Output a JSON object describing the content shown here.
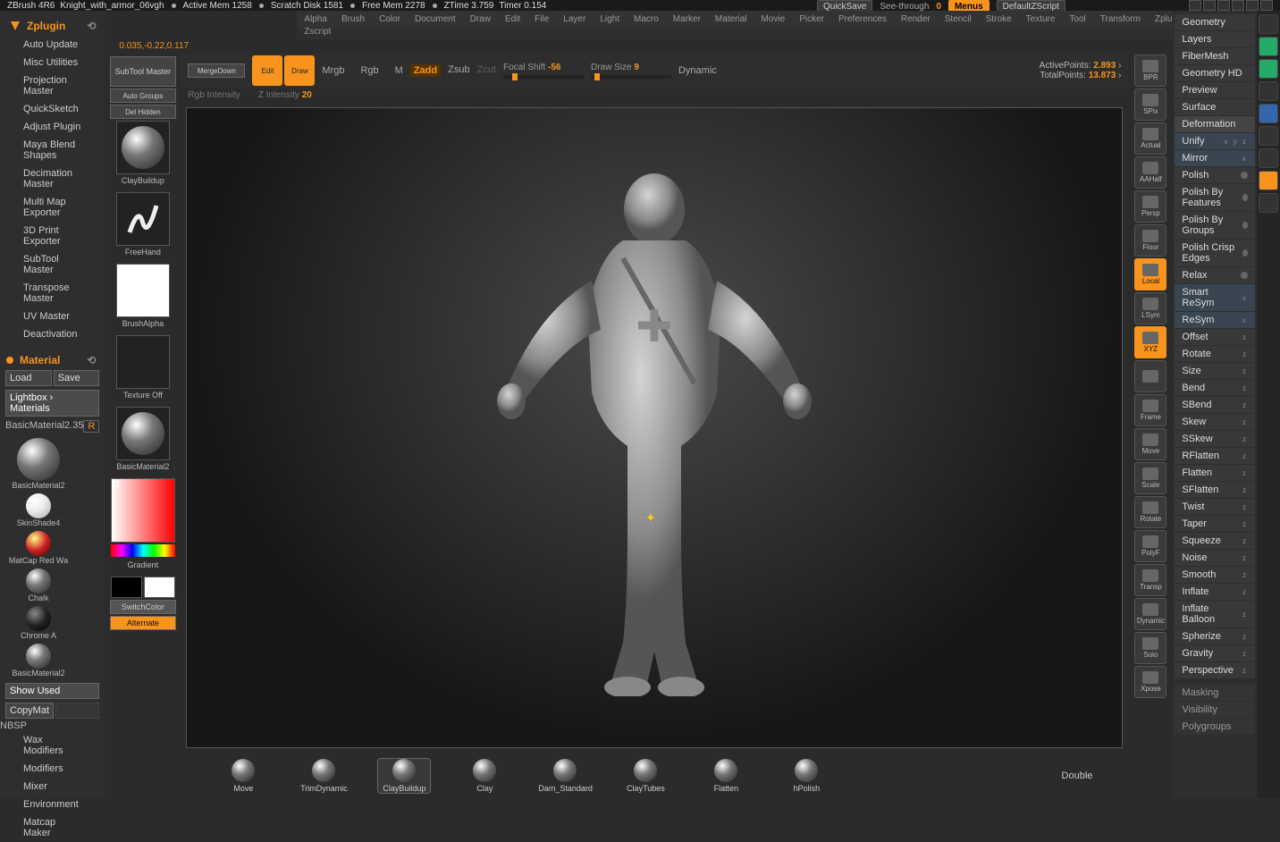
{
  "app": {
    "name": "ZBrush 4R6",
    "doc": "Knight_with_armor_06vgh"
  },
  "status": {
    "active_mem": "Active Mem 1258",
    "scratch": "Scratch Disk 1581",
    "free": "Free Mem 2278",
    "ztime": "ZTime  3.759",
    "timer": "Timer  0.154"
  },
  "header": {
    "quicksave": "QuickSave",
    "seethrough": "See-through",
    "seethrough_val": "0",
    "menus": "Menus",
    "zscript": "DefaultZScript"
  },
  "menu": [
    "Alpha",
    "Brush",
    "Color",
    "Document",
    "Draw",
    "Edit",
    "File",
    "Layer",
    "Light",
    "Macro",
    "Marker",
    "Material",
    "Movie",
    "Picker",
    "Preferences",
    "Render",
    "Stencil",
    "Stroke",
    "Texture",
    "Tool",
    "Transform",
    "Zplugin"
  ],
  "breadcrumb": "Zscript",
  "coords": "0.035,-0.22,0.117",
  "zplugin": {
    "title": "Zplugin",
    "items": [
      "Auto Update",
      "Misc Utilities",
      "Projection Master",
      "QuickSketch",
      "Adjust Plugin",
      "Maya Blend Shapes",
      "Decimation Master",
      "Multi Map Exporter",
      "3D Print Exporter",
      "SubTool Master",
      "Transpose Master",
      "UV Master",
      "Deactivation"
    ]
  },
  "material": {
    "title": "Material",
    "load": "Load",
    "save": "Save",
    "lightbox": "Lightbox › Materials",
    "base": "BasicMaterial2.",
    "baseval": "35",
    "r": "R",
    "thumbs": [
      "BasicMaterial2",
      "SkinShade4",
      "MatCap Red Wa",
      "Chalk",
      "Chrome A",
      "BasicMaterial2"
    ],
    "show_used": "Show Used",
    "copymat": "CopyMat",
    "extras": [
      "Wax Modifiers",
      "Modifiers",
      "Mixer",
      "Environment",
      "Matcap Maker"
    ]
  },
  "tool": {
    "subtool": "SubTool Master",
    "autogroups": "Auto Groups",
    "mergedown": "MergeDown",
    "delhidden": "Del Hidden",
    "brush": "ClayBuildup",
    "stroke": "FreeHand",
    "alpha": "BrushAlpha",
    "texture": "Texture Off",
    "mat": "BasicMaterial2",
    "gradient": "Gradient",
    "switch": "SwitchColor",
    "alternate": "Alternate"
  },
  "top": {
    "edit": "Edit",
    "draw": "Draw",
    "modes": [
      "Mrgb",
      "Rgb",
      "M"
    ],
    "zadd": "Zadd",
    "zsub": "Zsub",
    "zcut": "Zcut",
    "rgbint": "Rgb Intensity",
    "zint": "Z Intensity",
    "zint_val": "20",
    "focal": "Focal Shift",
    "focal_val": "-56",
    "draw_size": "Draw Size",
    "draw_size_val": "9",
    "dynamic": "Dynamic",
    "active": "ActivePoints:",
    "active_val": "2.893",
    "total": "TotalPoints:",
    "total_val": "13.873"
  },
  "dock": [
    "BPR",
    "SPix",
    "Actual",
    "AAHalf",
    "Persp",
    "Floor",
    "Local",
    "LSym",
    "XYZ",
    "",
    "Frame",
    "Move",
    "Scale",
    "Rotate",
    "PolyF",
    "Transp",
    "Dynamic",
    "Solo",
    "Xpose"
  ],
  "tray": [
    "Move",
    "TrimDynamic",
    "ClayBuildup",
    "Clay",
    "Dam_Standard",
    "ClayTubes",
    "Flatten",
    "hPolish"
  ],
  "tray_right": "Double",
  "right": {
    "sections": [
      "Geometry",
      "Layers",
      "FiberMesh",
      "Geometry HD",
      "Preview",
      "Surface"
    ],
    "deform_title": "Deformation",
    "unify": "Unify",
    "mirror": "Mirror",
    "polish": [
      "Polish",
      "Polish By Features",
      "Polish By Groups",
      "Polish Crisp Edges",
      "Relax"
    ],
    "smart_resym": "Smart ReSym",
    "resym": "ReSym",
    "sliders": [
      "Offset",
      "Rotate",
      "Size",
      "Bend",
      "SBend",
      "Skew",
      "SSkew",
      "RFlatten",
      "Flatten",
      "SFlatten",
      "Twist",
      "Taper",
      "Squeeze",
      "Noise",
      "Smooth",
      "Inflate",
      "Inflate Balloon",
      "Spherize",
      "Gravity",
      "Perspective"
    ],
    "bottom_items": [
      "Masking",
      "Visibility",
      "Polygroups"
    ]
  }
}
